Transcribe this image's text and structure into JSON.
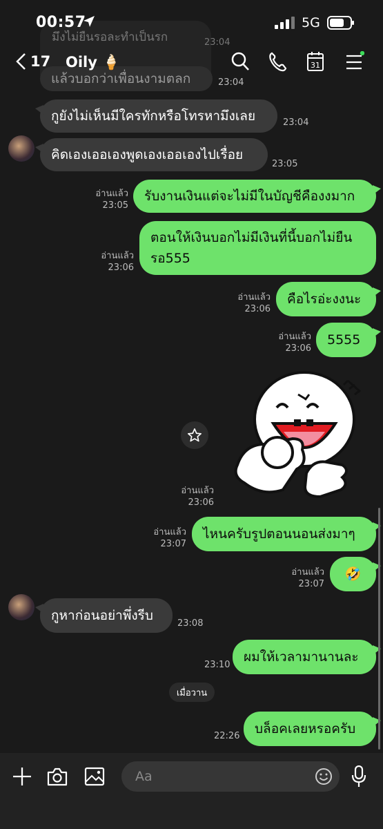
{
  "status_bar": {
    "time": "00:57",
    "network": "5G"
  },
  "header": {
    "back_count": "17",
    "chat_name": "Oily",
    "chat_emoji": "🍦"
  },
  "faded_messages": [
    "มึงไม่ยืนรอละทำเป็นรก",
    "แล้วบอกว่าเพื่อนงามตลก"
  ],
  "faded_time": "23:04",
  "messages": [
    {
      "text": "แล้วบอกว่าเพื่อนงามตลก",
      "time": "23:04"
    },
    {
      "text": "กูยังไม่เห็นมีใครทักหรือโทรหามึงเลย",
      "time": "23:04"
    },
    {
      "text": "คิดเองเออเองพูดเองเออเองไปเรื่อย",
      "time": "23:05"
    },
    {
      "text": "รับงานเงินแต่จะไม่มีในบัญชีคืองงมาก",
      "read": "อ่านแล้ว",
      "time": "23:05"
    },
    {
      "text": "ตอนให้เงินบอกไม่มีเงินที่นี้บอกไม่ยืน",
      "text2": "รอ555",
      "read": "อ่านแล้ว",
      "time": "23:06"
    },
    {
      "text": "คือไรอ่ะงงนะ",
      "read": "อ่านแล้ว",
      "time": "23:06"
    },
    {
      "text": "5555",
      "read": "อ่านแล้ว",
      "time": "23:06"
    },
    {
      "read": "อ่านแล้ว",
      "time": "23:06"
    },
    {
      "text": "ไหนครับรูปตอนนอนส่งมาๆ",
      "read": "อ่านแล้ว",
      "time": "23:07"
    },
    {
      "text": "🤣",
      "read": "อ่านแล้ว",
      "time": "23:07"
    },
    {
      "text": "กูหาก่อนอย่าพึ่งรีบ",
      "time": "23:08"
    },
    {
      "text": "ผมให้เวลามานานละ",
      "time": "23:10"
    },
    {
      "text": "บล็อคเลยหรอครับ",
      "time": "22:26"
    }
  ],
  "date_divider": "เมื่อวาน",
  "input": {
    "placeholder": "Aa"
  },
  "colors": {
    "background": "#1a1a1a",
    "incoming": "#3a3a3a",
    "outgoing": "#6ee26b",
    "notification_dot": "#3ddc5a"
  },
  "icons": [
    "back-chevron-icon",
    "search-icon",
    "phone-icon",
    "calendar-icon",
    "menu-icon",
    "star-icon",
    "plus-icon",
    "camera-icon",
    "image-icon",
    "emoji-icon",
    "microphone-icon"
  ]
}
